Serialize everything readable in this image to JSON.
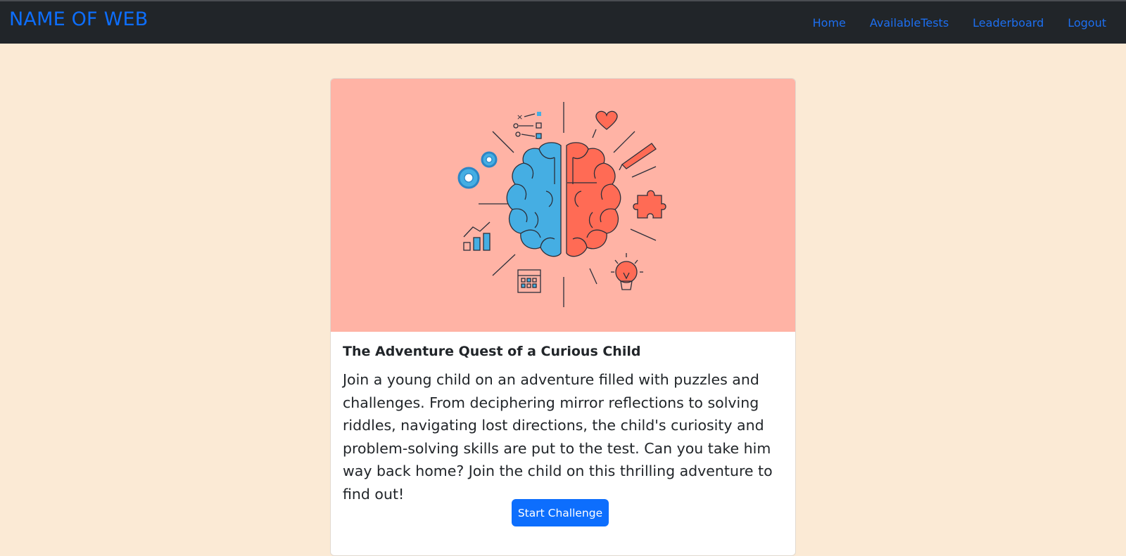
{
  "navbar": {
    "brand": "NAME OF WEB",
    "links": [
      "Home",
      "AvailableTests",
      "Leaderboard",
      "Logout"
    ],
    "colors": {
      "background": "#212529",
      "link": "#0d6efd"
    }
  },
  "page": {
    "background": "#fbead5"
  },
  "card": {
    "image_icon": "brain-illustration-icon",
    "image_background": "#ffb3a5",
    "title": "The Adventure Quest of a Curious Child",
    "text": "Join a young child on an adventure filled with puzzles and challenges. From deciphering mirror reflections to solving riddles, navigating lost directions, the child's curiosity and problem-solving skills are put to the test. Can you take him way back home? Join the child on this thrilling adventure to find out!",
    "button_label": "Start Challenge"
  }
}
